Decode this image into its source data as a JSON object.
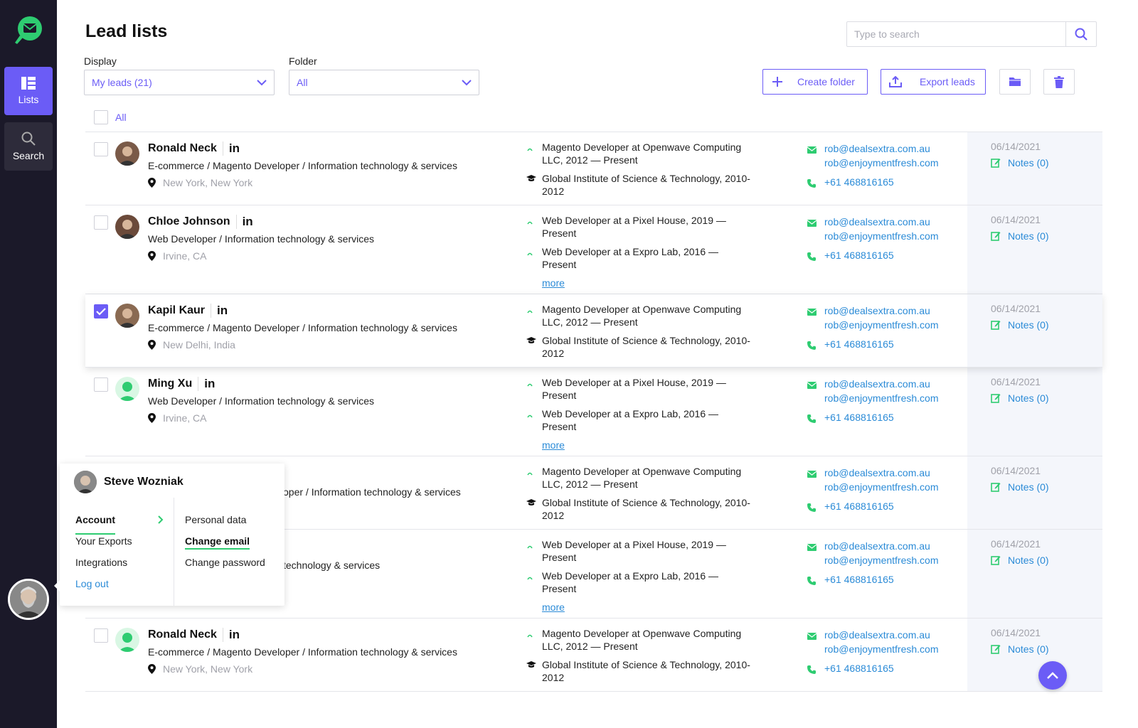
{
  "sidebar": {
    "nav": [
      {
        "label": "Lists",
        "icon": "list-icon"
      },
      {
        "label": "Search",
        "icon": "search-icon"
      }
    ]
  },
  "header": {
    "title": "Lead lists",
    "search_placeholder": "Type to search"
  },
  "filters": {
    "display_label": "Display",
    "display_value": "My leads (21)",
    "folder_label": "Folder",
    "folder_value": "All"
  },
  "actions": {
    "create_folder": "Create folder",
    "export_leads": "Export leads"
  },
  "select_all_label": "All",
  "leads": [
    {
      "name": "Ronald Neck",
      "title": "E-commerce / Magento Developer / Information technology & services",
      "location": "New York, New York",
      "checked": false,
      "experience": [
        "Magento Developer at Openwave Computing LLC, 2012 — Present",
        "Global Institute of Science & Technology, 2010-2012"
      ],
      "more": "",
      "email1": "rob@dealsextra.com.au",
      "email2": "rob@enjoymentfresh.com",
      "phone": "+61 468816165",
      "date": "06/14/2021",
      "notes": "Notes (0)"
    },
    {
      "name": "Chloe Johnson",
      "title": "Web Developer /  Information technology & services",
      "location": "Irvine, CA",
      "checked": false,
      "experience": [
        "Web Developer at a Pixel House, 2019 — Present",
        "Web Developer at a Expro Lab, 2016 — Present"
      ],
      "more": "more",
      "email1": "rob@dealsextra.com.au",
      "email2": "rob@enjoymentfresh.com",
      "phone": "+61 468816165",
      "date": "06/14/2021",
      "notes": "Notes (0)"
    },
    {
      "name": "Kapil Kaur",
      "title": "E-commerce / Magento Developer / Information technology & services",
      "location": "New Delhi, India",
      "checked": true,
      "experience": [
        "Magento Developer at Openwave Computing LLC, 2012 — Present",
        "Global Institute of Science & Technology, 2010-2012"
      ],
      "more": "",
      "email1": "rob@dealsextra.com.au",
      "email2": "rob@enjoymentfresh.com",
      "phone": "+61 468816165",
      "date": "06/14/2021",
      "notes": "Notes (0)"
    },
    {
      "name": "Ming Xu",
      "title": "Web Developer /  Information technology & services",
      "location": "Irvine, CA",
      "checked": false,
      "experience": [
        "Web Developer at a Pixel House, 2019 — Present",
        "Web Developer at a Expro Lab, 2016 — Present"
      ],
      "more": "more",
      "email1": "rob@dealsextra.com.au",
      "email2": "rob@enjoymentfresh.com",
      "phone": "+61 468816165",
      "date": "06/14/2021",
      "notes": "Notes (0)"
    },
    {
      "name": "",
      "title": "oper / Information technology & services",
      "location": "",
      "checked": false,
      "experience": [
        "Magento Developer at Openwave Computing LLC, 2012 — Present",
        "Global Institute of Science & Technology, 2010-2012"
      ],
      "more": "",
      "email1": "rob@dealsextra.com.au",
      "email2": "rob@enjoymentfresh.com",
      "phone": "+61 468816165",
      "date": "06/14/2021",
      "notes": "Notes (0)"
    },
    {
      "name": "",
      "title": "technology & services",
      "location": "",
      "checked": false,
      "experience": [
        "Web Developer at a Pixel House, 2019 — Present",
        "Web Developer at a Expro Lab, 2016 — Present"
      ],
      "more": "more",
      "email1": "rob@dealsextra.com.au",
      "email2": "rob@enjoymentfresh.com",
      "phone": "+61 468816165",
      "date": "06/14/2021",
      "notes": "Notes (0)"
    },
    {
      "name": "Ronald Neck",
      "title": "E-commerce / Magento Developer / Information technology & services",
      "location": "New York, New York",
      "checked": false,
      "experience": [
        "Magento Developer at Openwave Computing LLC, 2012 — Present",
        "Global Institute of Science & Technology, 2010-2012"
      ],
      "more": "",
      "email1": "rob@dealsextra.com.au",
      "email2": "rob@enjoymentfresh.com",
      "phone": "+61 468816165",
      "date": "06/14/2021",
      "notes": "Notes (0)"
    }
  ],
  "account_menu": {
    "user_name": "Steve Wozniak",
    "left": [
      "Account",
      "Your Exports",
      "Integrations",
      "Log out"
    ],
    "right": [
      "Personal data",
      "Change email",
      "Change password"
    ]
  },
  "colors": {
    "accent": "#6b5cf6",
    "link": "#2b8bd7",
    "green": "#2ecc71",
    "sidebar": "#1b1929"
  }
}
